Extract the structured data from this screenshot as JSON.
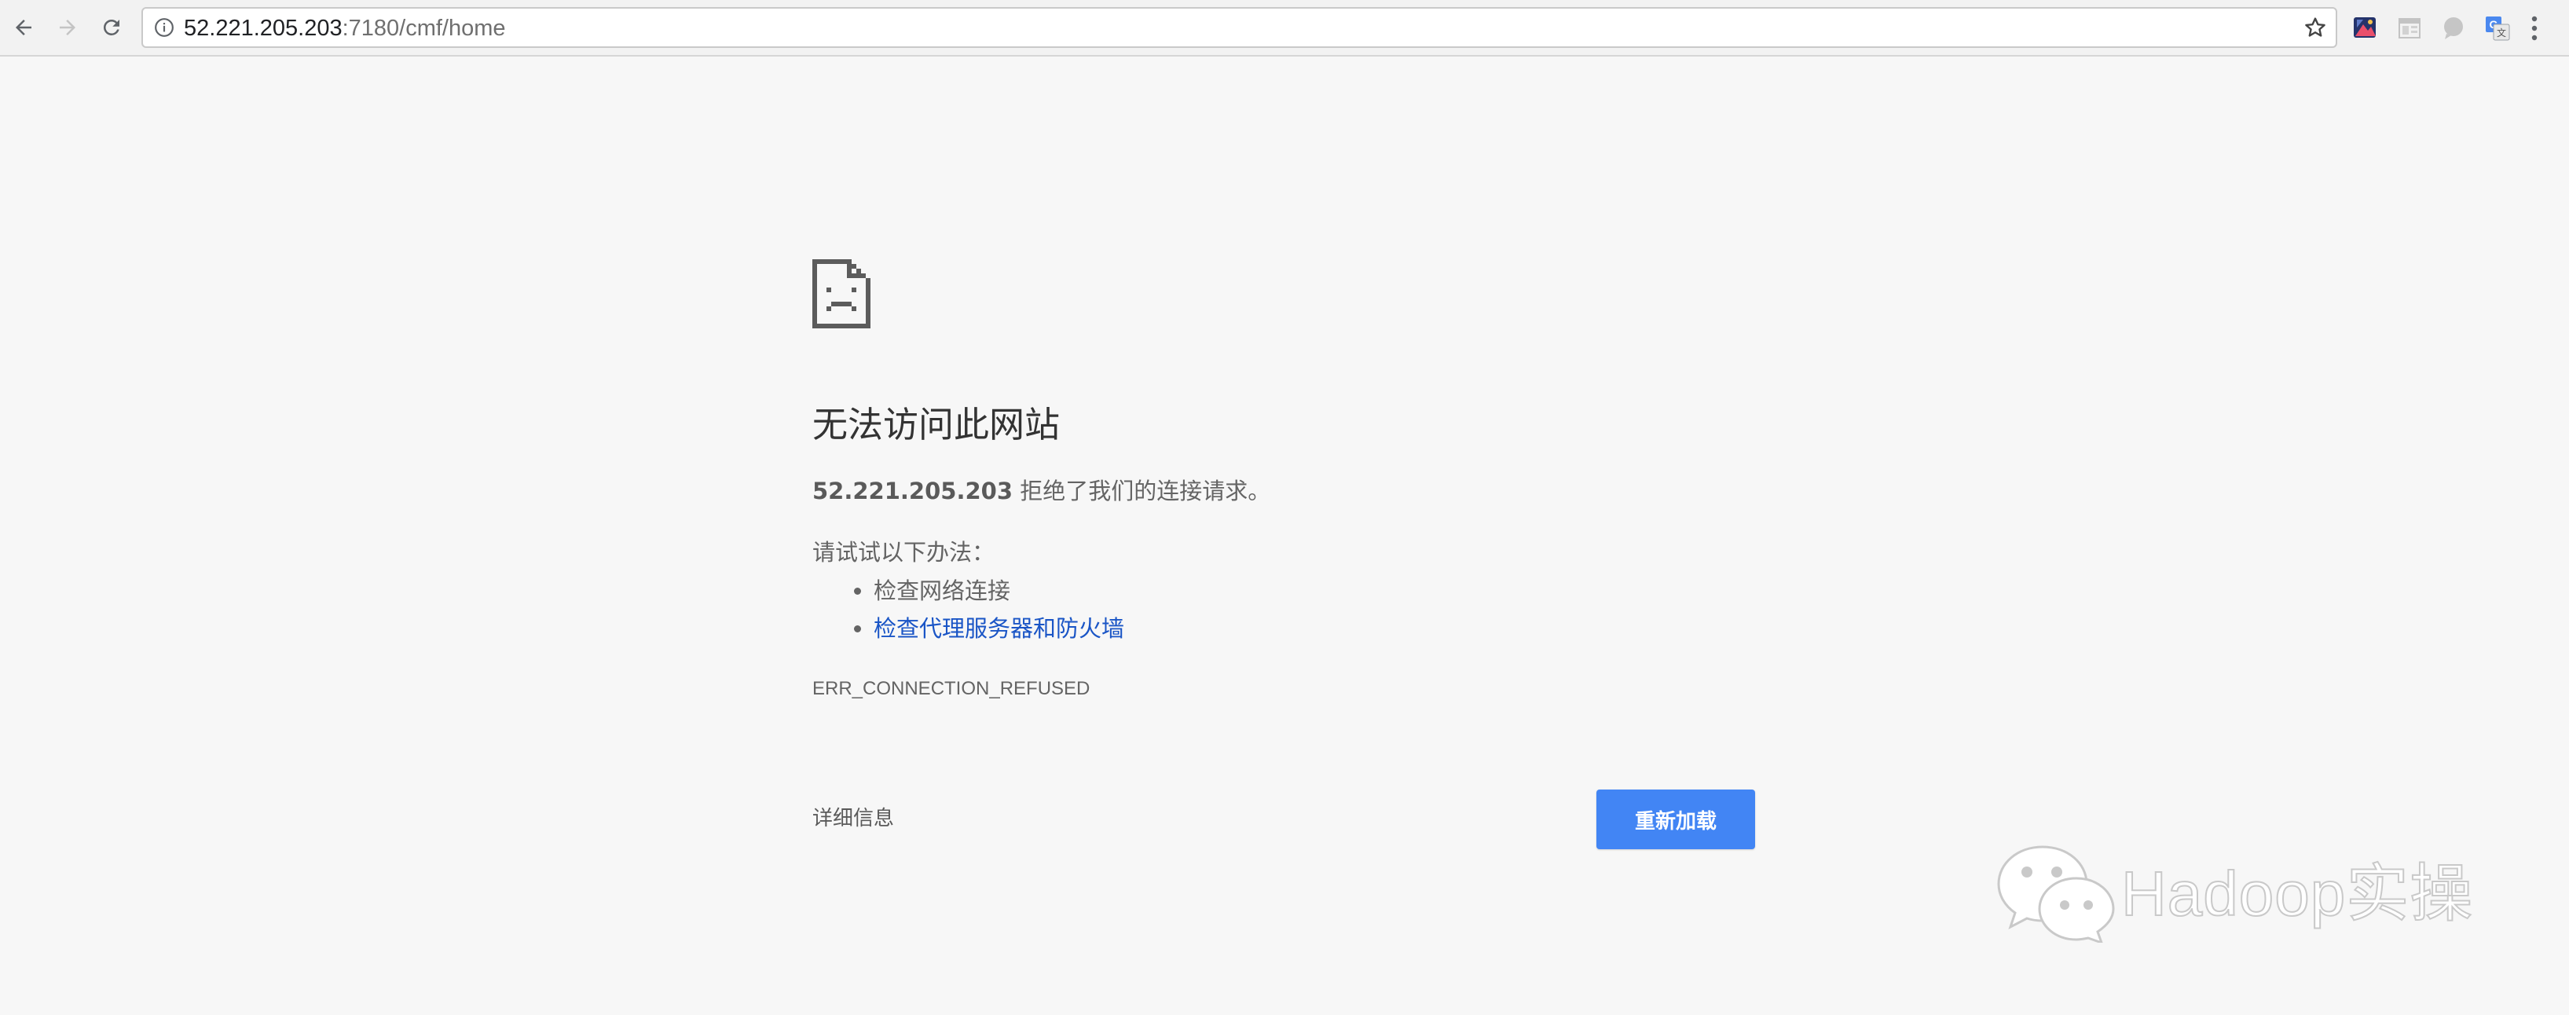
{
  "toolbar": {
    "url_host": "52.221.205.203",
    "url_rest": ":7180/cmf/home",
    "extensions": [
      "image-extension-icon",
      "reader-extension-icon",
      "chat-extension-icon",
      "translate-extension-icon"
    ]
  },
  "error_page": {
    "heading": "无法访问此网站",
    "host": "52.221.205.203",
    "summary_suffix": " 拒绝了我们的连接请求。",
    "suggestions_title": "请试试以下办法：",
    "suggestions": [
      "检查网络连接",
      "检查代理服务器和防火墙"
    ],
    "error_code": "ERR_CONNECTION_REFUSED",
    "details_label": "详细信息",
    "reload_label": "重新加载",
    "accent_color": "#4285f4",
    "link_color": "#1a55c6"
  },
  "watermark": {
    "text": "Hadoop实操"
  }
}
